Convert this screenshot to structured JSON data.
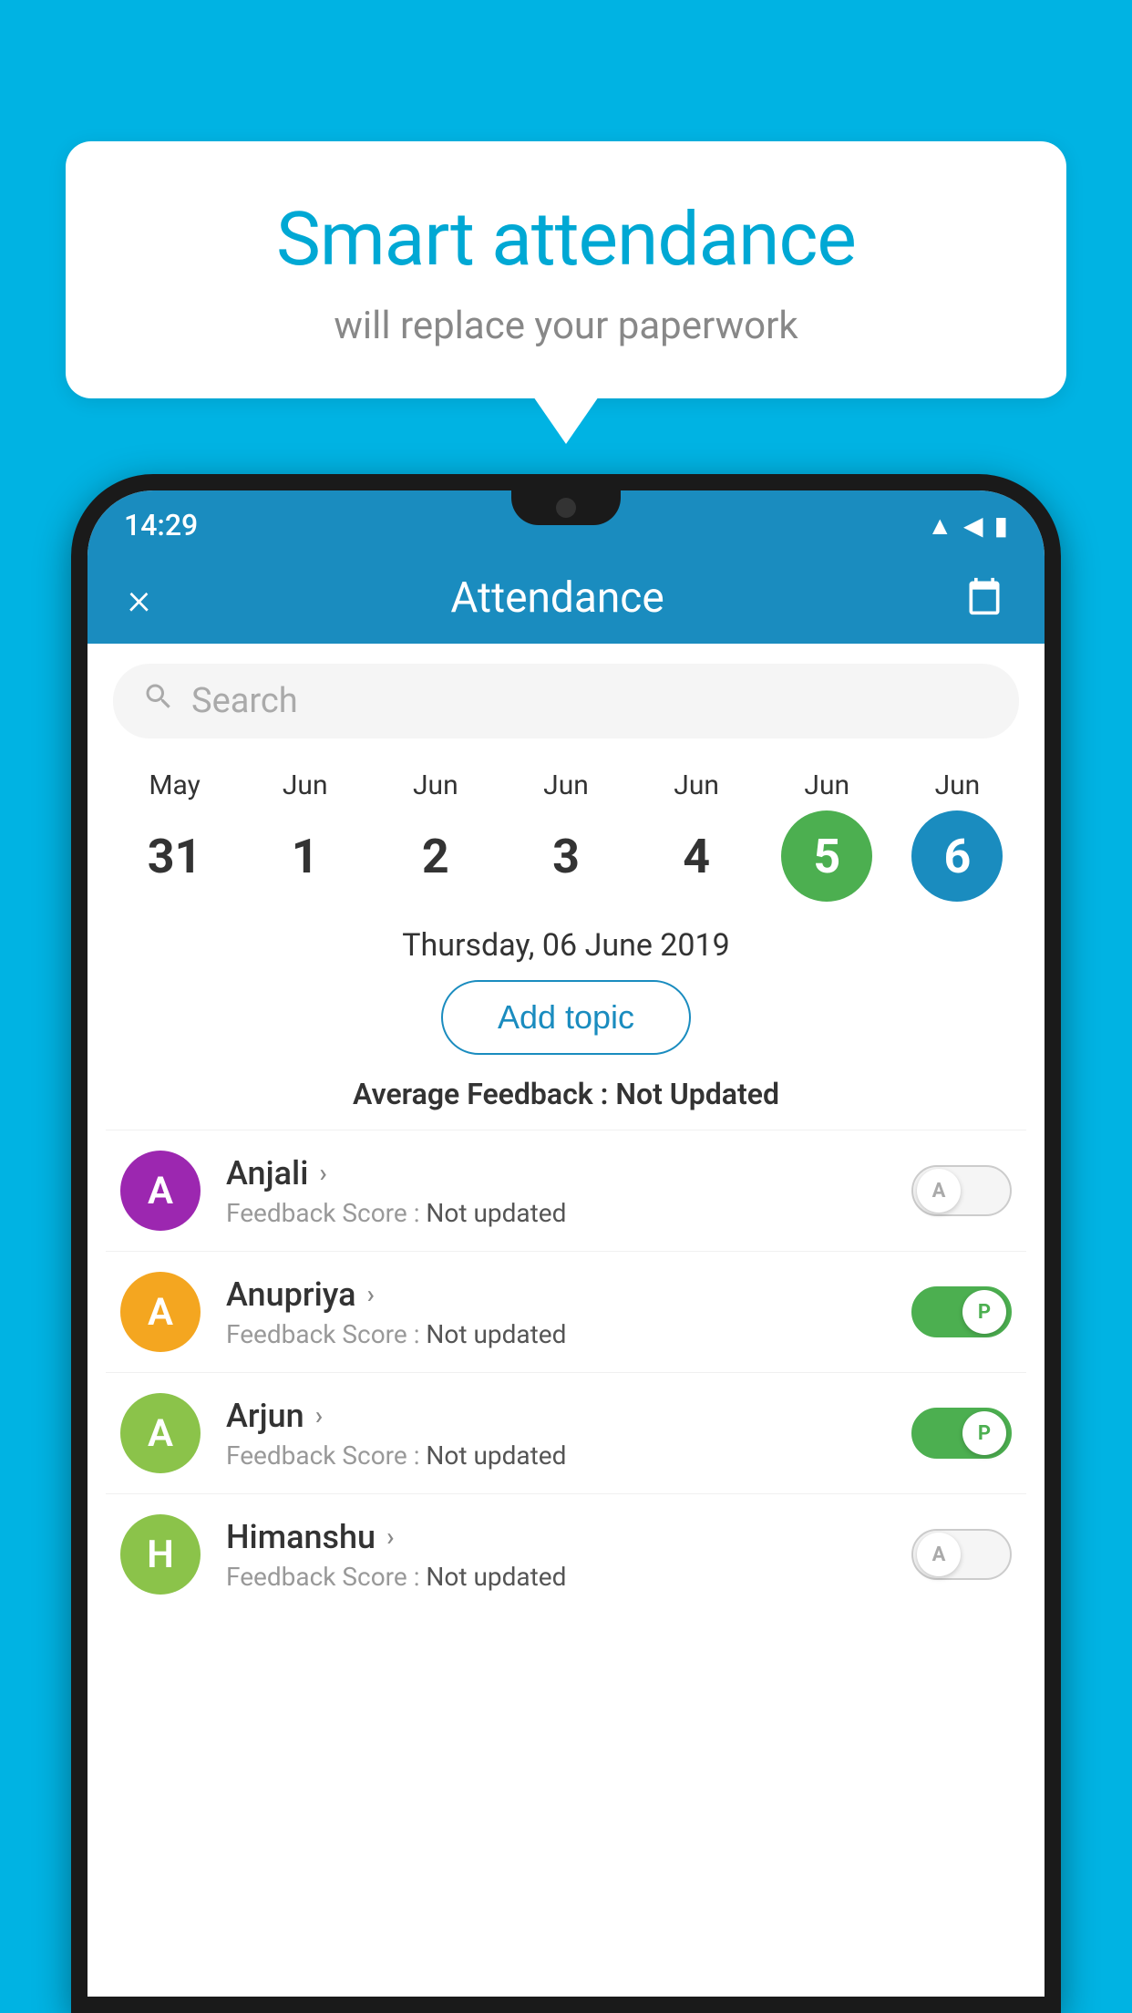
{
  "background_color": "#00b3e3",
  "speech_bubble": {
    "title": "Smart attendance",
    "subtitle": "will replace your paperwork"
  },
  "status_bar": {
    "time": "14:29",
    "wifi": "▲",
    "signal": "▲",
    "battery": "▮"
  },
  "app_header": {
    "title": "Attendance",
    "close_label": "×",
    "calendar_icon": "calendar-icon"
  },
  "search": {
    "placeholder": "Search"
  },
  "date_strip": {
    "dates": [
      {
        "month": "May",
        "day": "31",
        "state": "normal"
      },
      {
        "month": "Jun",
        "day": "1",
        "state": "normal"
      },
      {
        "month": "Jun",
        "day": "2",
        "state": "normal"
      },
      {
        "month": "Jun",
        "day": "3",
        "state": "normal"
      },
      {
        "month": "Jun",
        "day": "4",
        "state": "normal"
      },
      {
        "month": "Jun",
        "day": "5",
        "state": "today"
      },
      {
        "month": "Jun",
        "day": "6",
        "state": "selected"
      }
    ]
  },
  "selected_date": "Thursday, 06 June 2019",
  "add_topic_label": "Add topic",
  "avg_feedback": {
    "label": "Average Feedback : ",
    "value": "Not Updated"
  },
  "students": [
    {
      "name": "Anjali",
      "avatar_letter": "A",
      "avatar_color": "#9c27b0",
      "feedback_label": "Feedback Score : ",
      "feedback_value": "Not updated",
      "toggle_state": "off",
      "toggle_letter": "A"
    },
    {
      "name": "Anupriya",
      "avatar_letter": "A",
      "avatar_color": "#f4a620",
      "feedback_label": "Feedback Score : ",
      "feedback_value": "Not updated",
      "toggle_state": "on",
      "toggle_letter": "P"
    },
    {
      "name": "Arjun",
      "avatar_letter": "A",
      "avatar_color": "#8bc34a",
      "feedback_label": "Feedback Score : ",
      "feedback_value": "Not updated",
      "toggle_state": "on",
      "toggle_letter": "P"
    },
    {
      "name": "Himanshu",
      "avatar_letter": "H",
      "avatar_color": "#8bc34a",
      "feedback_label": "Feedback Score : ",
      "feedback_value": "Not updated",
      "toggle_state": "off",
      "toggle_letter": "A"
    }
  ]
}
